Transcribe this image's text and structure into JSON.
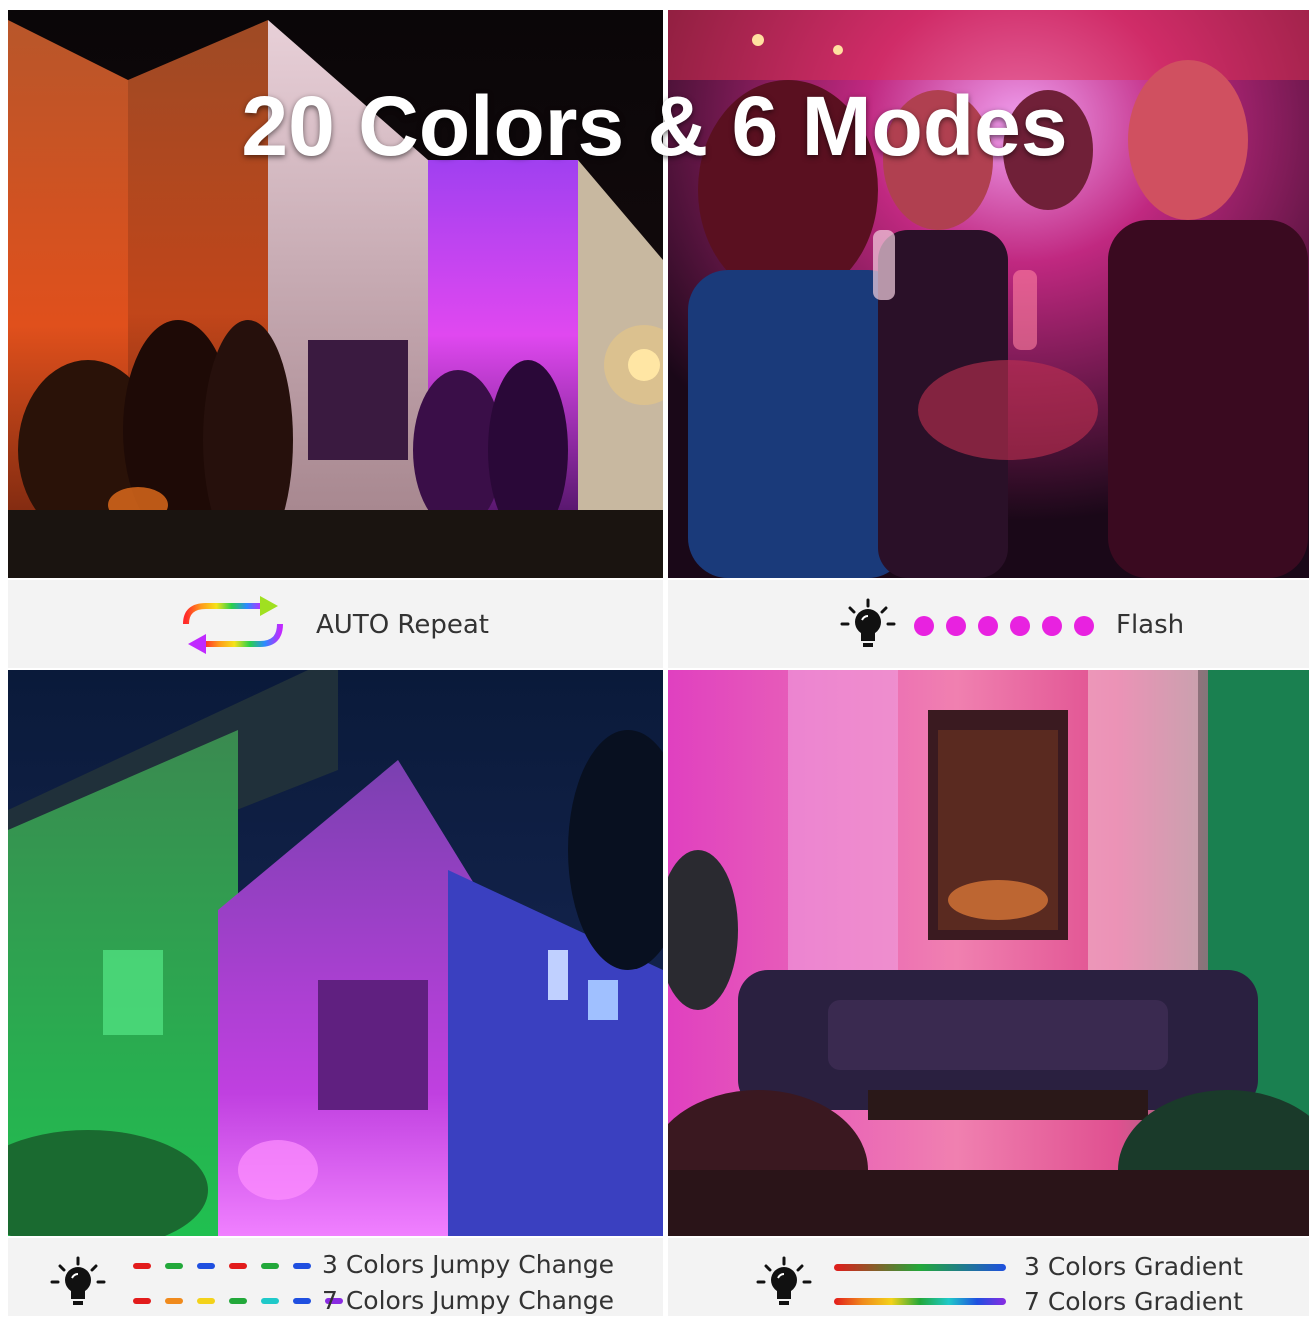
{
  "headline": "20 Colors & 6 Modes",
  "modes": {
    "auto_repeat": "AUTO Repeat",
    "flash": "Flash",
    "jumpy_3": "3 Colors Jumpy Change",
    "jumpy_7": "7 Colors Jumpy Change",
    "gradient_3": "3 Colors Gradient",
    "gradient_7": "7 Colors Gradient"
  },
  "icons": {
    "repeat": "rainbow-repeat-arrows-icon",
    "bulb": "lightbulb-icon"
  },
  "colors": {
    "flash_dot": "#e822e0",
    "jumpy_3": [
      "#e21b1b",
      "#22a83a",
      "#1f4fe0",
      "#e21b1b",
      "#22a83a",
      "#1f4fe0"
    ],
    "jumpy_7": [
      "#e21b1b",
      "#f08a1c",
      "#f3d21a",
      "#22a83a",
      "#1fc9c9",
      "#1f4fe0",
      "#8a2be2"
    ]
  }
}
